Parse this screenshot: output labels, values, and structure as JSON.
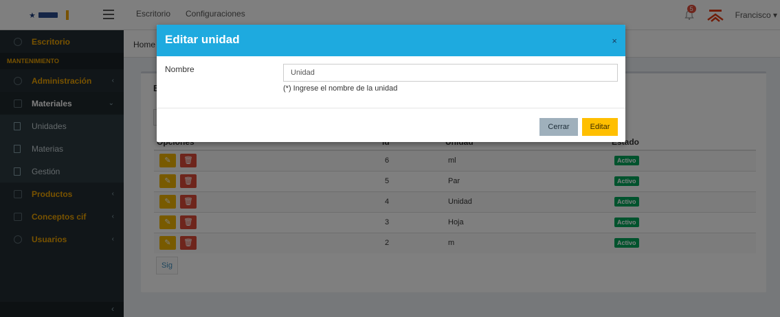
{
  "topbar": {
    "nav": [
      "Escritorio",
      "Configuraciones"
    ],
    "notifications_count": "5",
    "user_name": "Francisco",
    "user_caret": "▾"
  },
  "sidebar": {
    "escritorio": "Escritorio",
    "section_header": "MANTENIMIENTO",
    "administracion": "Administración",
    "materiales": "Materiales",
    "sub_items": [
      "Unidades",
      "Materias",
      "Gestión"
    ],
    "productos": "Productos",
    "conceptos": "Conceptos cif",
    "usuarios": "Usuarios",
    "collapse_icon": "‹"
  },
  "breadcrumb": {
    "home": "Home"
  },
  "box": {
    "title_initial": "E"
  },
  "table": {
    "headers": [
      "Opciones",
      "Id",
      "Unidad",
      "Estado"
    ],
    "rows": [
      {
        "id": "6",
        "unidad": "ml",
        "estado": "Activo"
      },
      {
        "id": "5",
        "unidad": "Par",
        "estado": "Activo"
      },
      {
        "id": "4",
        "unidad": "Unidad",
        "estado": "Activo"
      },
      {
        "id": "3",
        "unidad": "Hoja",
        "estado": "Activo"
      },
      {
        "id": "2",
        "unidad": "m",
        "estado": "Activo"
      }
    ]
  },
  "pagination": {
    "next_label": "Sig"
  },
  "modal": {
    "title": "Editar unidad",
    "close": "×",
    "field_label": "Nombre",
    "field_value": "Unidad",
    "field_help": "(*) Ingrese el nombre de la unidad",
    "cancel_label": "Cerrar",
    "submit_label": "Editar"
  },
  "colors": {
    "accent": "#f0a500",
    "modal_header": "#1eaadf",
    "edit_button": "#ffbf00",
    "delete_button": "#dd4b39",
    "active_label": "#00a65a",
    "sidebar_bg": "#222d32"
  }
}
